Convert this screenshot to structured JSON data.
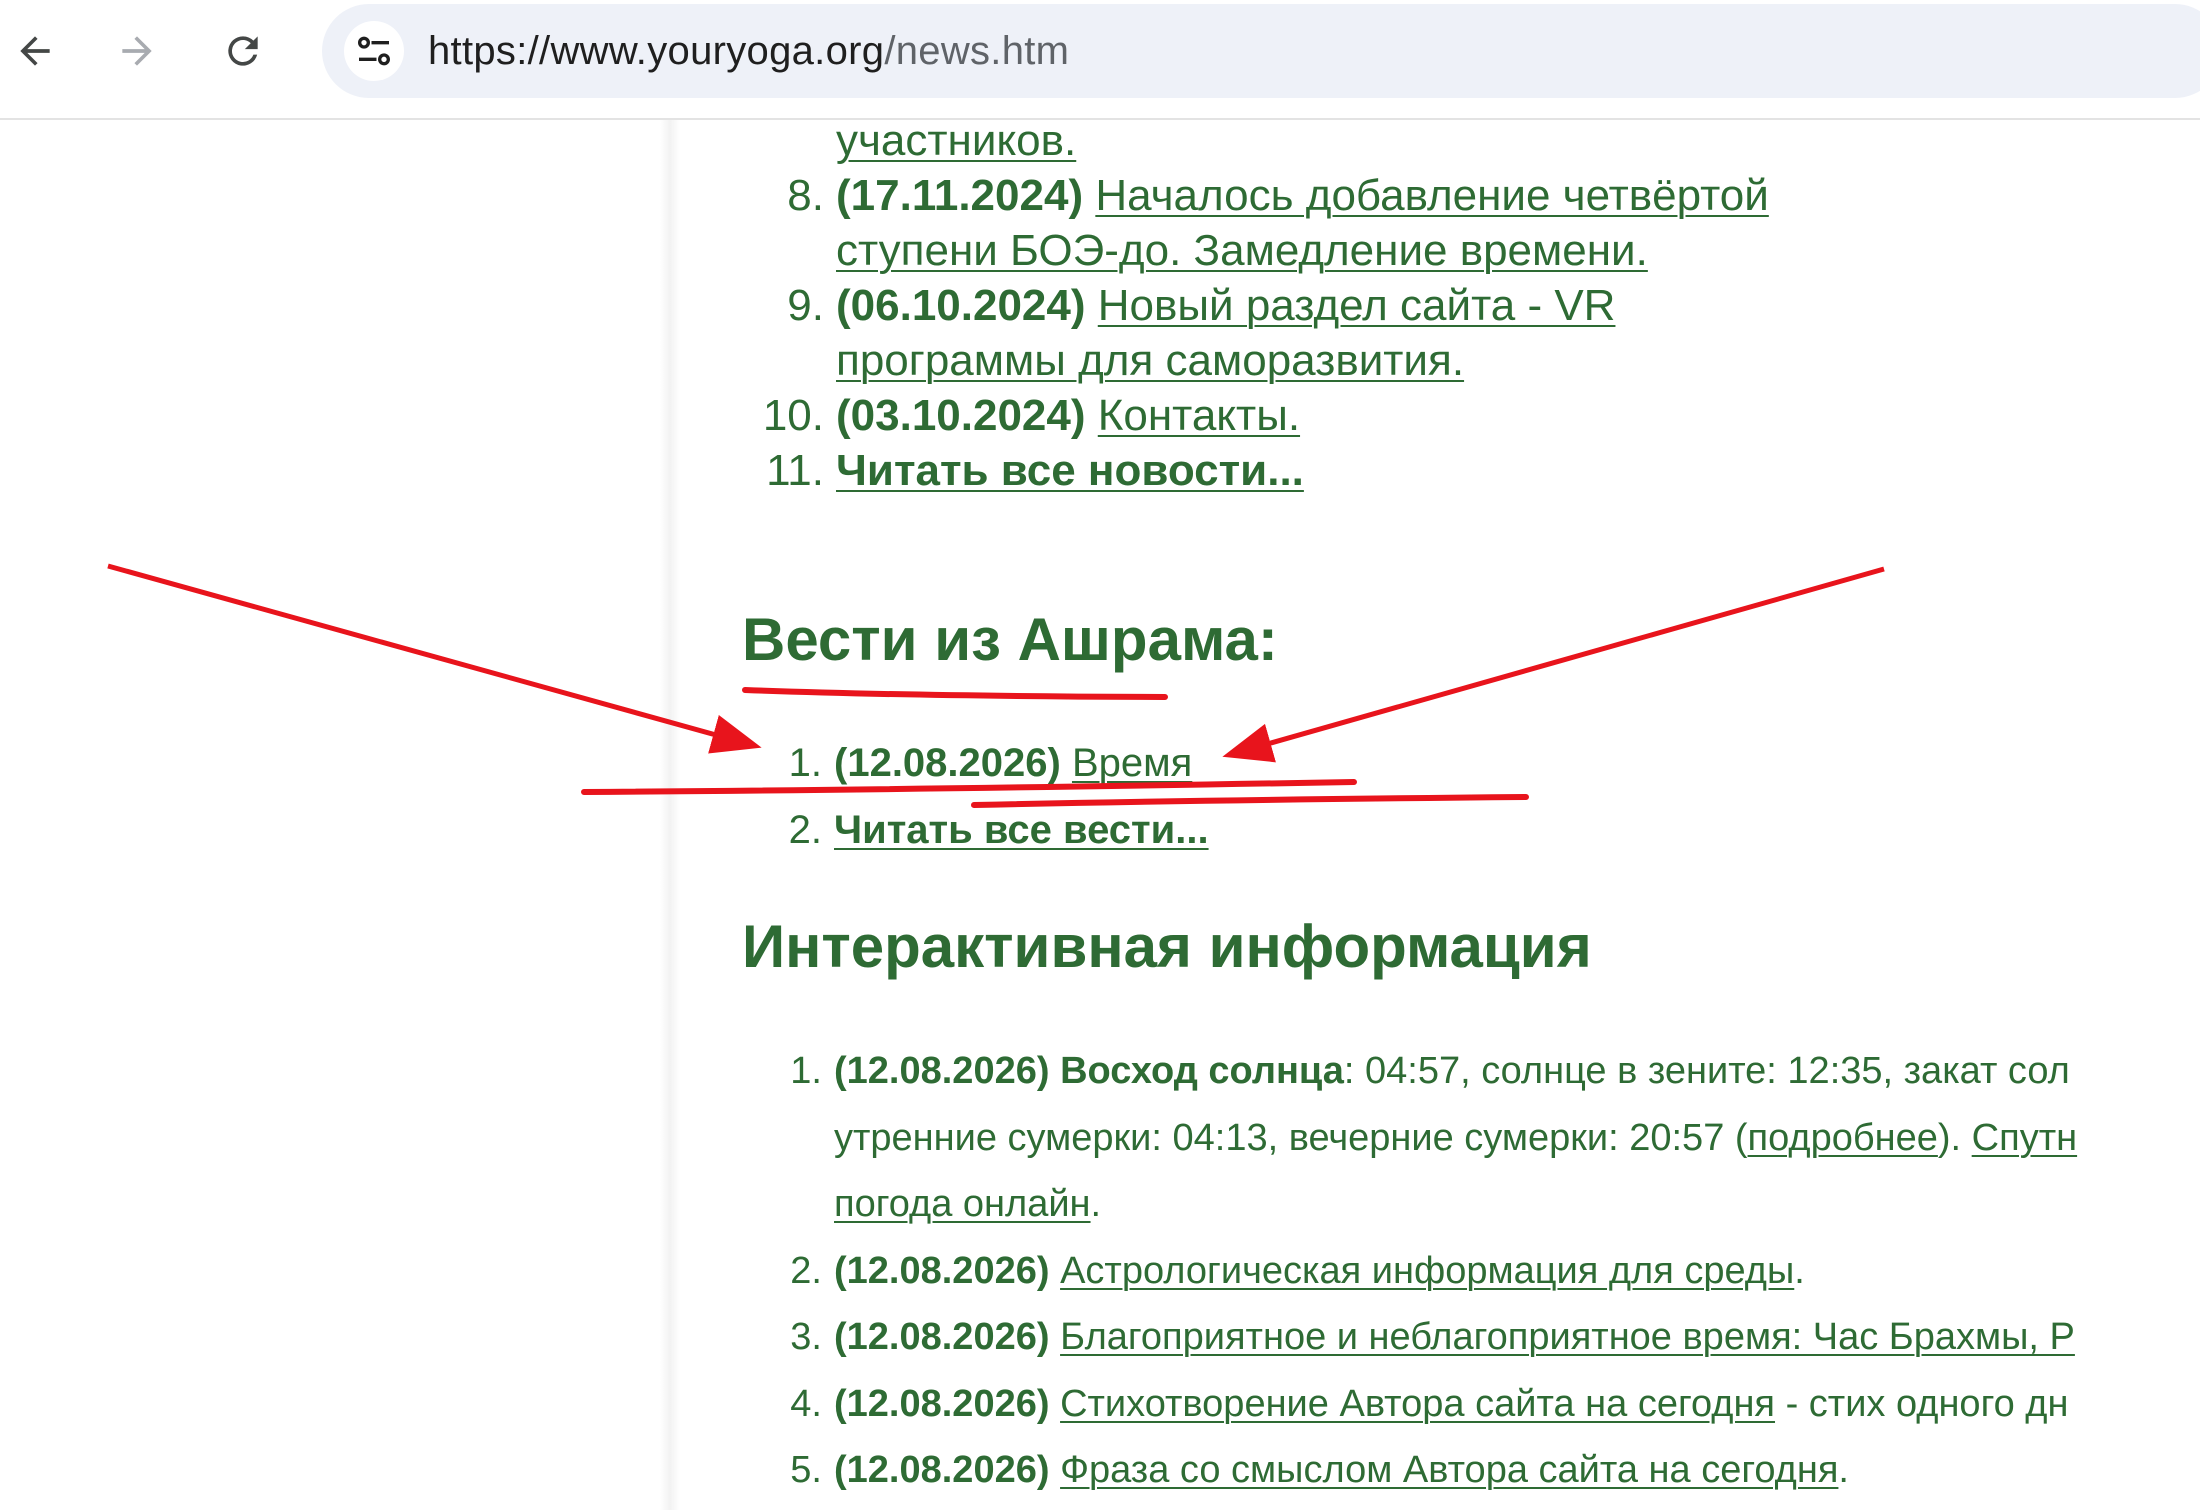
{
  "browser": {
    "url_host": "https://www.youryoga.org",
    "url_path": "/news.htm",
    "icons": [
      "back-arrow-icon",
      "forward-arrow-icon",
      "reload-icon",
      "site-settings-icon"
    ]
  },
  "news": {
    "items": [
      {
        "num": "",
        "lines": [
          "участников."
        ]
      },
      {
        "num": "8.",
        "date": "(17.11.2024)",
        "lines": [
          "Началось добавление четвёртой",
          "ступени БОЭ-до. Замедление времени."
        ]
      },
      {
        "num": "9.",
        "date": "(06.10.2024)",
        "lines": [
          "Новый раздел сайта - VR",
          "программы для саморазвития."
        ]
      },
      {
        "num": "10.",
        "date": "(03.10.2024)",
        "lines": [
          "Контакты."
        ]
      },
      {
        "num": "11.",
        "bold_link": "Читать все новости..."
      }
    ]
  },
  "ashram": {
    "heading": "Вести из Ашрама:",
    "items": [
      {
        "num": "1.",
        "date": "(12.08.2026)",
        "link": "Время"
      },
      {
        "num": "2.",
        "bold_link": "Читать все вести..."
      }
    ]
  },
  "interactive": {
    "heading": "Интерактивная информация",
    "item1": {
      "num": "1.",
      "date": "(12.08.2026)",
      "label": "Восход солнца",
      "text1": ": 04:57, солнце в зените: 12:35, закат сол",
      "text2": "утренние сумерки: 04:13, вечерние сумерки: 20:57 (",
      "link_more": "подробнее",
      "text3": "). ",
      "link_sat": "Спутн",
      "link_weather": "погода онлайн",
      "text4": "."
    },
    "item2": {
      "num": "2.",
      "date": "(12.08.2026)",
      "link": "Астрологическая информация для среды",
      "suffix": "."
    },
    "item3": {
      "num": "3.",
      "date": "(12.08.2026)",
      "link": "Благоприятное и неблагоприятное время: Час Брахмы, Р"
    },
    "item4": {
      "num": "4.",
      "date": "(12.08.2026)",
      "link": "Стихотворение Автора сайта на сегодня",
      "suffix": " - стих одного дн"
    },
    "item5": {
      "num": "5.",
      "date": "(12.08.2026)",
      "link": "Фраза со смыслом Автора сайта на сегодня",
      "suffix": "."
    }
  },
  "colors": {
    "text_green": "#2e6b34",
    "annotation_red": "#e8141c",
    "omnibox_bg": "#eef1f8"
  }
}
